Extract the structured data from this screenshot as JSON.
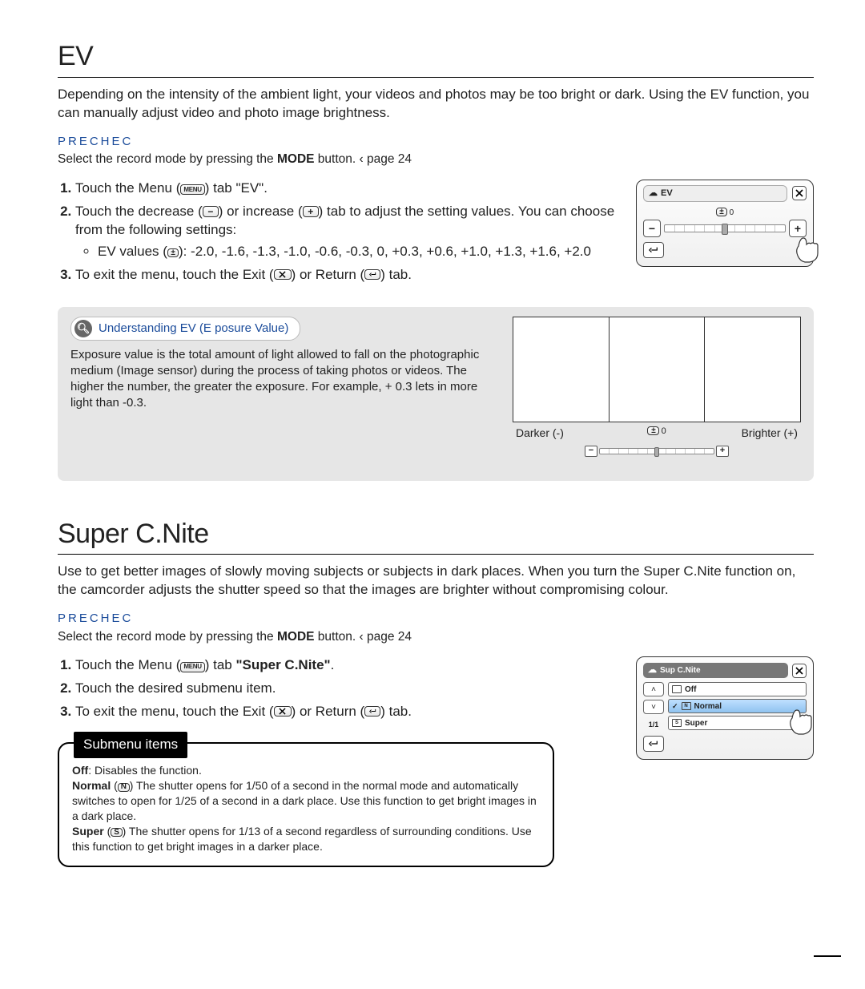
{
  "ev": {
    "title": "EV",
    "intro": "Depending on the intensity of the ambient light, your videos and photos may be too bright or dark. Using the EV function, you can manually adjust video and photo image brightness.",
    "precheck_label": "PRECHEC",
    "precheck_note_a": "Select the record mode by pressing the ",
    "precheck_note_b": "MODE",
    "precheck_note_c": " button.   ‹ page 24",
    "step1_a": "Touch the Menu (",
    "step1_b": ") tab     ",
    "step1_c": "\"EV\"",
    "step1_d": ".",
    "step2_a": "Touch the decrease (",
    "step2_b": ") or increase (",
    "step2_c": ") tab to adjust the setting values. You can choose from the following settings:",
    "step2_values_a": "EV values (",
    "step2_values_b": "): -2.0, -1.6, -1.3, -1.0, -0.6, -0.3, 0, +0.3, +0.6, +1.0, +1.3, +1.6, +2.0",
    "step3_a": "To exit the menu, touch the Exit (",
    "step3_b": ") or Return (",
    "step3_c": ") tab.",
    "device": {
      "title": "EV",
      "indicator": "0"
    },
    "info": {
      "pill_label": "Understanding EV (E posure Value)",
      "body": "Exposure value is the total amount of light allowed to fall on the photographic medium (Image sensor) during the process of taking photos or videos. The higher the number, the greater the exposure. For example, + 0.3 lets in more light than -0.3.",
      "darker": "Darker (-)",
      "mid": "0",
      "brighter": "Brighter (+)"
    }
  },
  "scn": {
    "title": "Super C.Nite",
    "intro": "Use to get better images of slowly moving subjects or subjects in dark places. When you turn the Super C.Nite function on, the camcorder adjusts the shutter speed so that the images are brighter without compromising colour.",
    "precheck_label": "PRECHEC",
    "precheck_note_a": "Select the record mode by pressing the ",
    "precheck_note_b": "MODE",
    "precheck_note_c": " button.   ‹ page 24",
    "step1_a": "Touch the Menu (",
    "step1_b": ") tab     ",
    "step1_c": "\"Super C.Nite\"",
    "step1_d": ".",
    "step2": "Touch the desired submenu item.",
    "step3_a": "To exit the menu, touch the Exit (",
    "step3_b": ") or Return (",
    "step3_c": ") tab.",
    "device": {
      "title": "Sup C.Nite",
      "items": [
        "Off",
        "Normal",
        "Super"
      ],
      "page": "1/1"
    },
    "submenu": {
      "tab": "Submenu items",
      "off_a": "Off",
      "off_b": ": Disables the function.",
      "normal_a": "Normal",
      "normal_b": " (",
      "normal_c": ")  The shutter opens for 1/50 of a second in the normal mode and automatically switches to open for 1/25 of a second in a dark place. Use this function to get bright images in a dark place.",
      "super_a": "Super",
      "super_b": " (",
      "super_c": ")  The shutter opens for 1/13 of a second regardless of surrounding conditions. Use this function to get bright images in a darker place."
    }
  },
  "icons": {
    "menu": "MENU",
    "minus": "−",
    "plus": "+",
    "ev_square": "±",
    "shutter_n": "N",
    "shutter_s": "S"
  }
}
